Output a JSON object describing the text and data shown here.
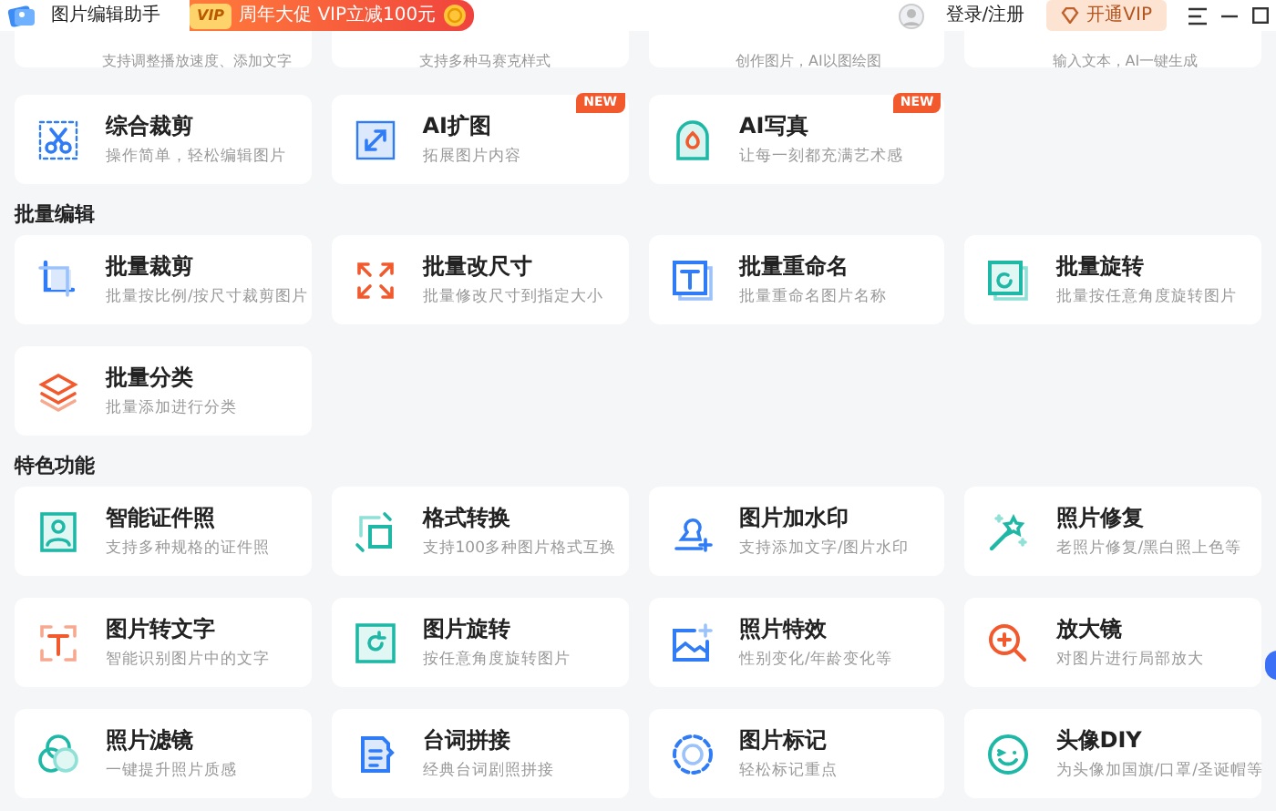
{
  "header": {
    "app_title": "图片编辑助手",
    "promo": {
      "badge": "VIP",
      "text": "周年大促 VIP立减100元"
    },
    "login": "登录/注册",
    "vip_button": "开通VIP"
  },
  "partial_cards": [
    "支持调整播放速度、添加文字",
    "支持多种马赛克样式",
    "创作图片，AI以图绘图",
    "输入文本，AI一键生成"
  ],
  "cards": [
    {
      "title": "综合裁剪",
      "description": "操作简单，轻松编辑图片"
    },
    {
      "title": "AI扩图",
      "description": "拓展图片内容",
      "badge": "NEW"
    },
    {
      "title": "AI写真",
      "description": "让每一刻都充满艺术感",
      "badge": "NEW"
    }
  ],
  "sections": [
    {
      "title": "批量编辑",
      "cards": [
        {
          "title": "批量裁剪",
          "description": "批量按比例/按尺寸裁剪图片"
        },
        {
          "title": "批量改尺寸",
          "description": "批量修改尺寸到指定大小"
        },
        {
          "title": "批量重命名",
          "description": "批量重命名图片名称"
        },
        {
          "title": "批量旋转",
          "description": "批量按任意角度旋转图片"
        },
        {
          "title": "批量分类",
          "description": "批量添加进行分类"
        }
      ]
    },
    {
      "title": "特色功能",
      "cards": [
        {
          "title": "智能证件照",
          "description": "支持多种规格的证件照"
        },
        {
          "title": "格式转换",
          "description": "支持100多种图片格式互换"
        },
        {
          "title": "图片加水印",
          "description": "支持添加文字/图片水印"
        },
        {
          "title": "照片修复",
          "description": "老照片修复/黑白照上色等"
        },
        {
          "title": "图片转文字",
          "description": "智能识别图片中的文字"
        },
        {
          "title": "图片旋转",
          "description": "按任意角度旋转图片"
        },
        {
          "title": "照片特效",
          "description": "性别变化/年龄变化等"
        },
        {
          "title": "放大镜",
          "description": "对图片进行局部放大"
        },
        {
          "title": "照片滤镜",
          "description": "一键提升照片质感"
        },
        {
          "title": "台词拼接",
          "description": "经典台词剧照拼接"
        },
        {
          "title": "图片标记",
          "description": "轻松标记重点"
        },
        {
          "title": "头像DIY",
          "description": "为头像加国旗/口罩/圣诞帽等"
        }
      ]
    }
  ]
}
